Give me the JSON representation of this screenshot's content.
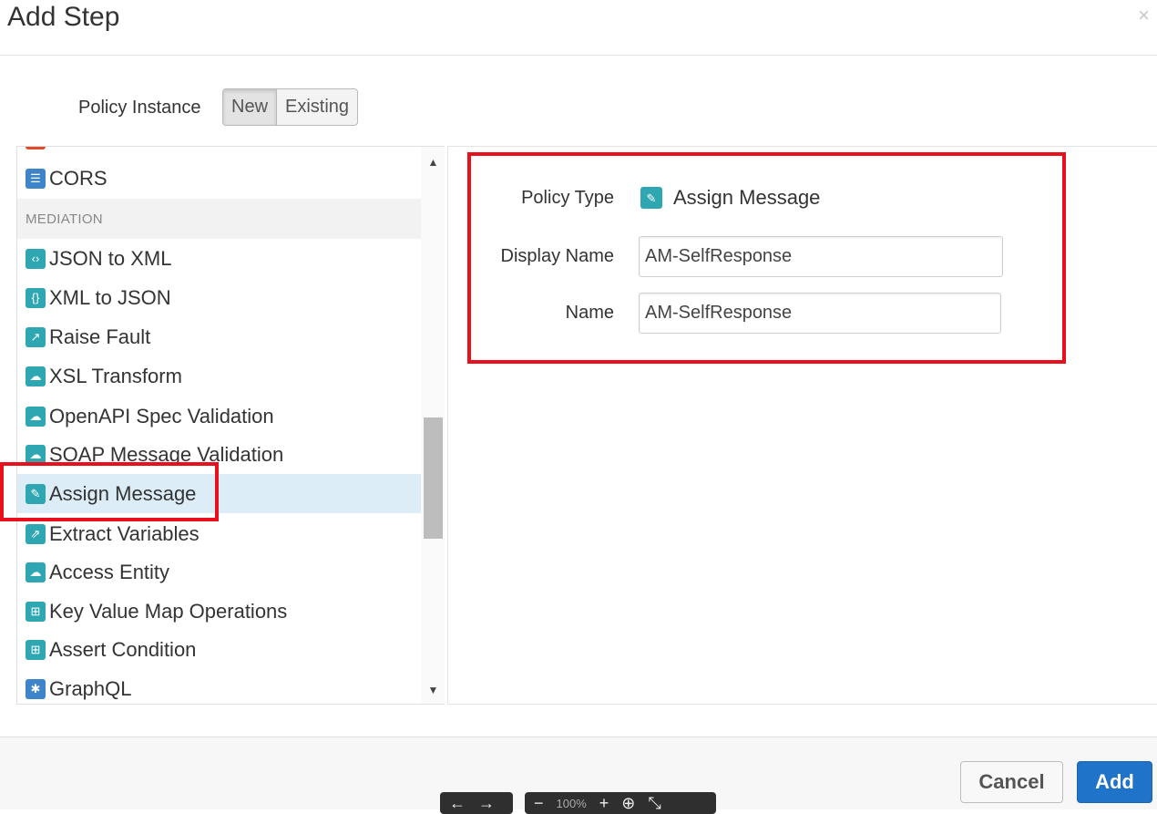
{
  "dialog": {
    "title": "Add Step",
    "close_glyph": "×"
  },
  "policy_instance": {
    "label": "Policy Instance",
    "options": [
      "New",
      "Existing"
    ],
    "selected": "New"
  },
  "list": {
    "items": [
      {
        "label": "CORS",
        "icon": "cors-icon",
        "color": "#3d84c8",
        "glyph": "☰"
      },
      {
        "label": "JSON to XML",
        "icon": "json-to-xml-icon",
        "color": "#2fa7b3",
        "glyph": "‹›"
      },
      {
        "label": "XML to JSON",
        "icon": "xml-to-json-icon",
        "color": "#2fa7b3",
        "glyph": "{}"
      },
      {
        "label": "Raise Fault",
        "icon": "raise-fault-icon",
        "color": "#2fa7b3",
        "glyph": "↗"
      },
      {
        "label": "XSL Transform",
        "icon": "xsl-transform-icon",
        "color": "#2fa7b3",
        "glyph": "☁"
      },
      {
        "label": "OpenAPI Spec Validation",
        "icon": "openapi-validation-icon",
        "color": "#2fa7b3",
        "glyph": "☁"
      },
      {
        "label": "SOAP Message Validation",
        "icon": "soap-validation-icon",
        "color": "#2fa7b3",
        "glyph": "☁"
      },
      {
        "label": "Assign Message",
        "icon": "assign-message-icon",
        "color": "#2fa7b3",
        "glyph": "✎"
      },
      {
        "label": "Extract Variables",
        "icon": "extract-variables-icon",
        "color": "#2fa7b3",
        "glyph": "⇗"
      },
      {
        "label": "Access Entity",
        "icon": "access-entity-icon",
        "color": "#2fa7b3",
        "glyph": "☁"
      },
      {
        "label": "Key Value Map Operations",
        "icon": "key-value-map-icon",
        "color": "#2fa7b3",
        "glyph": "⊞"
      },
      {
        "label": "Assert Condition",
        "icon": "assert-condition-icon",
        "color": "#2fa7b3",
        "glyph": "⊞"
      },
      {
        "label": "GraphQL",
        "icon": "graphql-icon",
        "color": "#3d84c8",
        "glyph": "✱"
      }
    ],
    "group_label": "MEDIATION",
    "selected": "Assign Message"
  },
  "form": {
    "policy_type_label": "Policy Type",
    "policy_type_value": "Assign Message",
    "display_name_label": "Display Name",
    "display_name_value": "AM-SelfResponse",
    "name_label": "Name",
    "name_value": "AM-SelfResponse"
  },
  "footer": {
    "cancel_label": "Cancel",
    "add_label": "Add"
  },
  "viewer": {
    "zoom": "100%"
  },
  "colors": {
    "highlight": "#e8101c",
    "primary": "#1f73c9",
    "icon_teal": "#2fa7b3",
    "icon_blue": "#3d84c8",
    "selected_row": "#dcedf7"
  }
}
